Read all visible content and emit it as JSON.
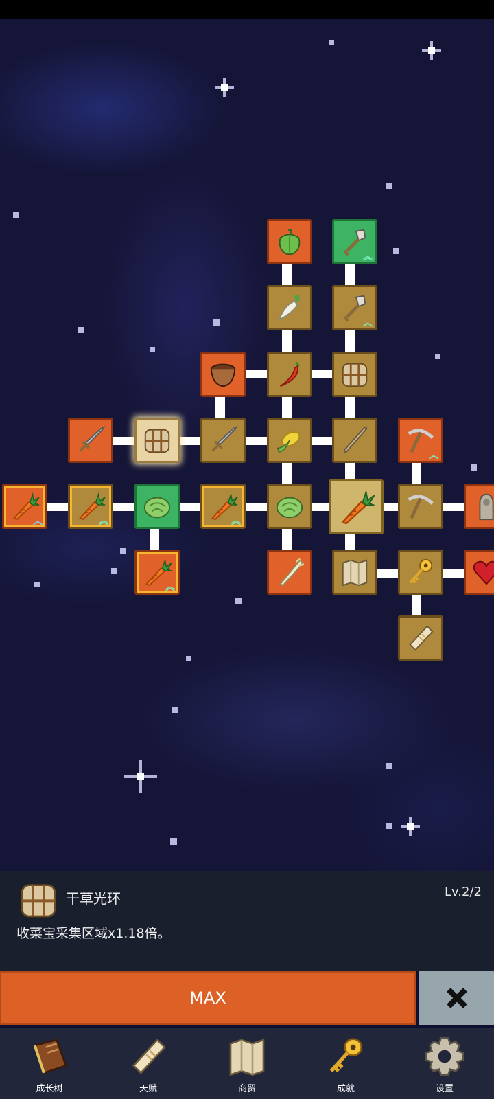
{
  "skill_panel": {
    "icon": "hay-bale-icon",
    "title": "干草光环",
    "level": "Lv.2/2",
    "description": "收菜宝采集区域x1.18倍。"
  },
  "actions": {
    "max_label": "MAX",
    "close_icon": "close-icon"
  },
  "nav": [
    {
      "label": "成长树",
      "icon": "book-icon"
    },
    {
      "label": "天赋",
      "icon": "scroll-icon"
    },
    {
      "label": "商贸",
      "icon": "map-icon"
    },
    {
      "label": "成就",
      "icon": "key-icon"
    },
    {
      "label": "设置",
      "icon": "gear-icon"
    }
  ],
  "skill_tree_nodes": [
    {
      "id": "pepper",
      "icon": "bell-pepper-icon"
    },
    {
      "id": "shovel-2",
      "icon": "shovel-icon"
    },
    {
      "id": "radish",
      "icon": "radish-icon"
    },
    {
      "id": "shovel-1",
      "icon": "shovel-icon"
    },
    {
      "id": "bowl",
      "icon": "bowl-icon"
    },
    {
      "id": "chili",
      "icon": "chili-icon"
    },
    {
      "id": "hay-1",
      "icon": "hay-bale-icon"
    },
    {
      "id": "sword-1",
      "icon": "sword-icon"
    },
    {
      "id": "hay-2",
      "icon": "hay-bale-icon"
    },
    {
      "id": "sword-2",
      "icon": "sword-icon"
    },
    {
      "id": "corn",
      "icon": "corn-icon"
    },
    {
      "id": "stick",
      "icon": "stick-icon"
    },
    {
      "id": "pickaxe-2",
      "icon": "pickaxe-icon"
    },
    {
      "id": "carrot-1",
      "icon": "carrot-icon"
    },
    {
      "id": "carrot-2",
      "icon": "carrot-icon"
    },
    {
      "id": "cabbage-1",
      "icon": "cabbage-icon"
    },
    {
      "id": "carrot-3",
      "icon": "carrot-icon"
    },
    {
      "id": "cabbage-2",
      "icon": "cabbage-icon"
    },
    {
      "id": "carrot-center",
      "icon": "carrot-icon"
    },
    {
      "id": "pickaxe-1",
      "icon": "pickaxe-icon"
    },
    {
      "id": "statue",
      "icon": "statue-icon"
    },
    {
      "id": "carrot-4",
      "icon": "carrot-icon"
    },
    {
      "id": "leek",
      "icon": "leek-icon"
    },
    {
      "id": "map",
      "icon": "map-icon"
    },
    {
      "id": "key",
      "icon": "key-icon"
    },
    {
      "id": "heart",
      "icon": "heart-icon"
    },
    {
      "id": "scroll",
      "icon": "scroll-icon"
    }
  ]
}
